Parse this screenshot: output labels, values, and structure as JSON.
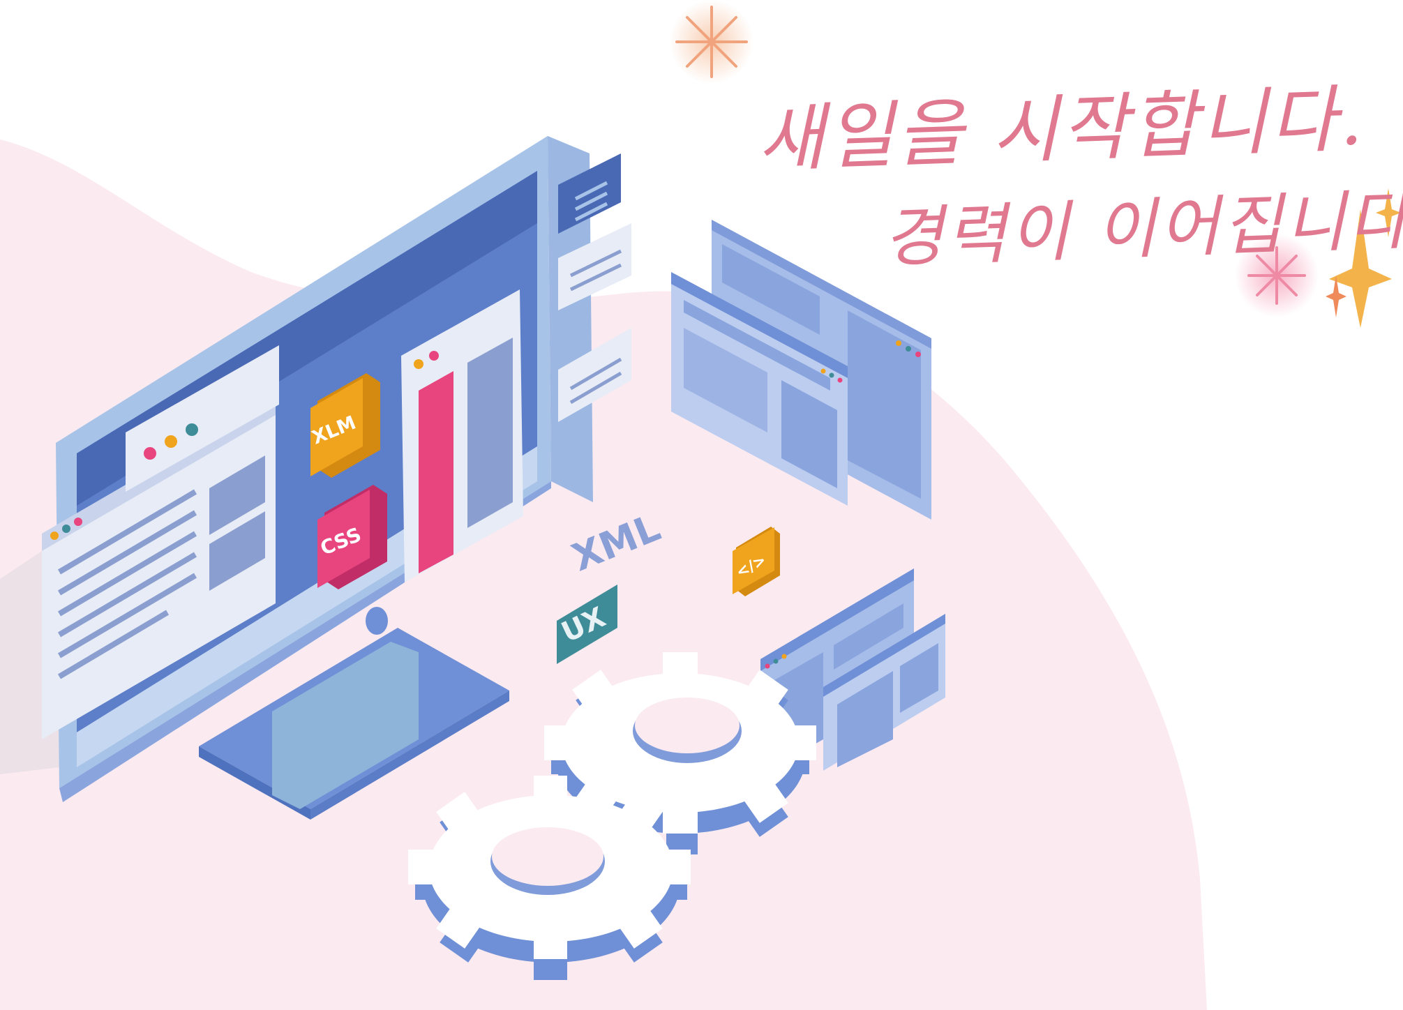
{
  "headline": {
    "line1": "새일을 시작합니다.",
    "line2": "경력이 이어집니다."
  },
  "badges": {
    "xlm": "XLM",
    "css": "CSS",
    "xml": "XML",
    "ux": "UX",
    "code": "</>"
  },
  "colors": {
    "background_blob": "#fbeaf0",
    "headline": "#e0788f",
    "monitor_frame": "#a8c3e8",
    "screen": "#5d7fc9",
    "window": "#e8ecf6",
    "accent_orange": "#f0a31d",
    "accent_pink": "#e8447e",
    "teal": "#3f8c99",
    "gear": "#ffffff",
    "gear_side": "#6f90d6"
  },
  "icons": [
    "sparkle-icon",
    "gear-icon",
    "monitor-illustration",
    "browser-window-icon",
    "code-icon"
  ]
}
